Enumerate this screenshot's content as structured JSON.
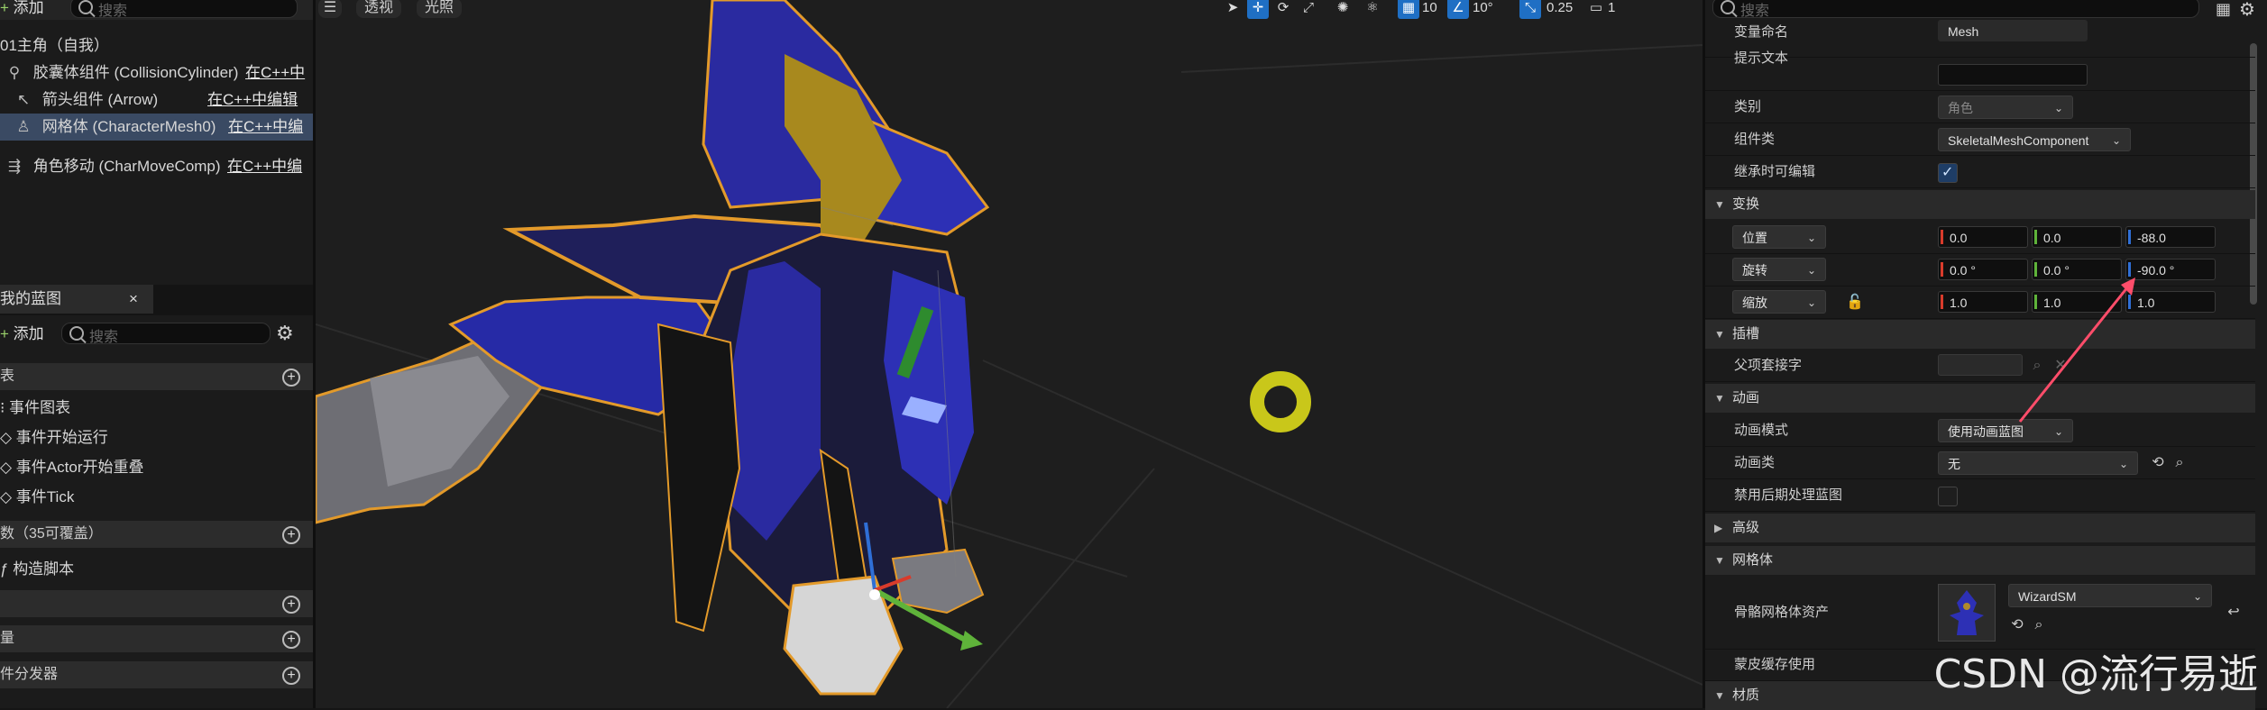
{
  "left_panel": {
    "top_add": "添加",
    "top_search_placeholder": "搜索",
    "components": [
      {
        "icon": "",
        "label": "01主角（自我）",
        "link": ""
      },
      {
        "icon": "capsule-icon",
        "label": "胶囊体组件 (CollisionCylinder)",
        "link": "在C++中"
      },
      {
        "icon": "arrow-icon",
        "label": "箭头组件 (Arrow)",
        "link": "在C++中编辑"
      },
      {
        "icon": "skeletal-mesh-icon",
        "label": "网格体 (CharacterMesh0)",
        "link": "在C++中编"
      },
      {
        "icon": "movement-icon",
        "label": "角色移动 (CharMoveComp)",
        "link": "在C++中编"
      }
    ],
    "my_blueprint_tab": "我的蓝图",
    "tab_close": "×",
    "bp_add": "添加",
    "bp_search_placeholder": "搜索",
    "graphs_header": "表",
    "event_graph": "事件图表",
    "events": [
      "事件开始运行",
      "事件Actor开始重叠",
      "事件Tick"
    ],
    "functions_header": "数（35可覆盖）",
    "construction_script": "构造脚本",
    "macros_header": "",
    "variables_header": "量",
    "dispatchers_header": "件分发器"
  },
  "viewport": {
    "perspective_label": "透视",
    "lighting_label": "光照",
    "grid_snap_value": "10",
    "rotation_snap_value": "10°",
    "scale_snap_value": "0.25",
    "camera_speed_value": "1"
  },
  "details": {
    "search_placeholder": "搜索",
    "variable_name_label": "变量命名",
    "variable_name_value": "Mesh",
    "tooltip_label": "提示文本",
    "tooltip_value": "",
    "category_label": "类别",
    "category_value": "角色",
    "component_class_label": "组件类",
    "component_class_value": "SkeletalMeshComponent",
    "editable_inherit_label": "继承时可编辑",
    "editable_inherit_checked": true,
    "transform_section": "变换",
    "location_label": "位置",
    "location": [
      "0.0",
      "0.0",
      "-88.0"
    ],
    "rotation_label": "旋转",
    "rotation": [
      "0.0 °",
      "0.0 °",
      "-90.0 °"
    ],
    "scale_label": "缩放",
    "scale": [
      "1.0",
      "1.0",
      "1.0"
    ],
    "sockets_section": "插槽",
    "parent_socket_label": "父项套接字",
    "animation_section": "动画",
    "anim_mode_label": "动画模式",
    "anim_mode_value": "使用动画蓝图",
    "anim_class_label": "动画类",
    "anim_class_value": "无",
    "disable_post_process_label": "禁用后期处理蓝图",
    "advanced_section": "高级",
    "mesh_section": "网格体",
    "skeletal_mesh_asset_label": "骨骼网格体资产",
    "skeletal_mesh_asset_value": "WizardSM",
    "skin_cache_label": "蒙皮缓存使用",
    "material_section": "材质"
  },
  "watermark": "CSDN @流行易逝",
  "colors": {
    "x_axis": "#d93b2b",
    "y_axis": "#5fb33a",
    "z_axis": "#2f6fd6",
    "selection": "#3a4a63",
    "annotation_arrow": "#ff4d6a"
  }
}
